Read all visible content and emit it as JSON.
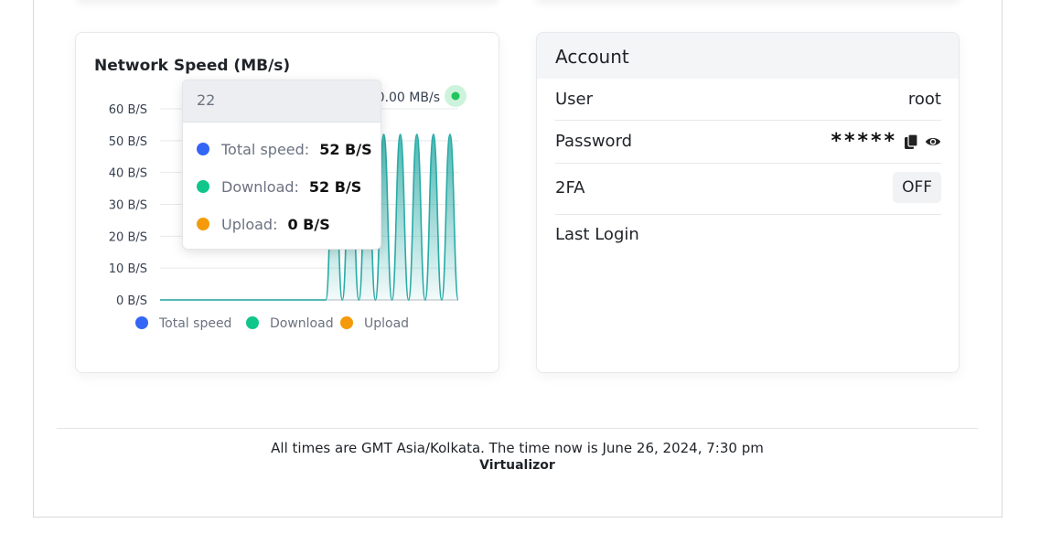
{
  "network_card": {
    "title": "Network Speed (MB/s)",
    "current_speed": "0.00 MB/s",
    "tooltip": {
      "header": "22",
      "rows": [
        {
          "name": "Total speed:",
          "value": "52 B/S",
          "color": "#3366f5"
        },
        {
          "name": "Download:",
          "value": "52 B/S",
          "color": "#10c68a"
        },
        {
          "name": "Upload:",
          "value": "0 B/S",
          "color": "#f59a0a"
        }
      ]
    },
    "legend": [
      {
        "label": "Total speed",
        "color": "#3366f5"
      },
      {
        "label": "Download",
        "color": "#10c68a"
      },
      {
        "label": "Upload",
        "color": "#f59a0a"
      }
    ]
  },
  "chart_data": {
    "type": "area",
    "title": "Network Speed (MB/s)",
    "y_ticks": [
      "0 B/S",
      "10 B/S",
      "20 B/S",
      "30 B/S",
      "40 B/S",
      "50 B/S",
      "60 B/S"
    ],
    "ylim": [
      0,
      60
    ],
    "x": [
      0,
      1,
      2,
      3,
      4,
      5,
      6,
      7,
      8,
      9,
      10,
      11,
      12,
      13,
      14,
      15,
      16,
      17,
      18,
      19,
      20,
      21,
      22,
      23,
      24,
      25,
      26,
      27,
      28,
      29,
      30,
      31,
      32,
      33,
      34,
      35,
      36
    ],
    "series": [
      {
        "name": "Download",
        "color": "#2aaba6",
        "values": [
          0,
          0,
          0,
          0,
          0,
          0,
          0,
          0,
          0,
          0,
          0,
          0,
          0,
          0,
          0,
          0,
          0,
          0,
          0,
          0,
          0,
          52,
          0,
          52,
          0,
          52,
          0,
          52,
          0,
          52,
          0,
          52,
          0,
          52,
          0,
          52,
          0
        ]
      },
      {
        "name": "Upload",
        "color": "#f59a0a",
        "values": []
      },
      {
        "name": "Total speed",
        "color": "#3366f5",
        "values": []
      }
    ],
    "grid": true,
    "legend_position": "bottom"
  },
  "account": {
    "title": "Account",
    "rows": [
      {
        "label": "User",
        "value": "root"
      },
      {
        "label": "Password",
        "value": "*****"
      },
      {
        "label": "2FA",
        "value": "OFF"
      },
      {
        "label": "Last Login",
        "value": ""
      }
    ],
    "icons": {
      "copy": "copy-icon",
      "show": "eye-icon"
    }
  },
  "footer": {
    "timezone_note": "All times are GMT Asia/Kolkata. The time now is June 26, 2024, 7:30 pm",
    "brand": "Virtualizor"
  }
}
